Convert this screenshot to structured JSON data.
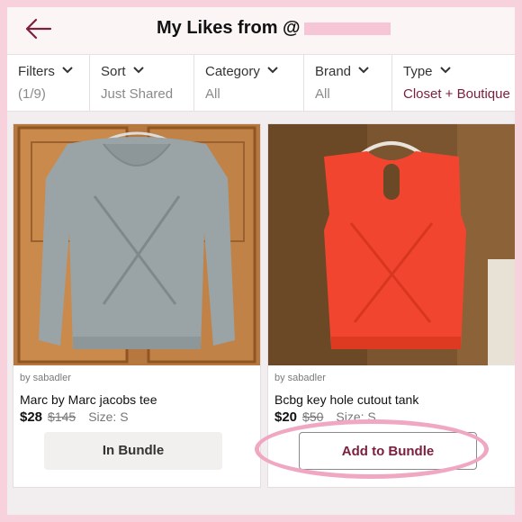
{
  "header": {
    "title": "My Likes from @",
    "back_icon": "back-arrow-icon"
  },
  "filters": [
    {
      "label": "Filters",
      "value": "(1/9)"
    },
    {
      "label": "Sort",
      "value": "Just Shared"
    },
    {
      "label": "Category",
      "value": "All"
    },
    {
      "label": "Brand",
      "value": "All"
    },
    {
      "label": "Type",
      "value": "Closet + Boutique"
    }
  ],
  "products": [
    {
      "seller": "by sabadler",
      "name": "Marc by Marc jacobs tee",
      "price": "$28",
      "original_price": "$145",
      "size": "Size: S",
      "button_label": "In Bundle",
      "color": "#9aa4a6"
    },
    {
      "seller": "by sabadler",
      "name": "Bcbg key hole cutout tank",
      "price": "$20",
      "original_price": "$50",
      "size": "Size: S",
      "button_label": "Add to Bundle",
      "color": "#f2452f"
    }
  ],
  "colors": {
    "accent": "#7a1f3d",
    "highlight": "#efa7c2",
    "border": "#f7d1dc"
  }
}
